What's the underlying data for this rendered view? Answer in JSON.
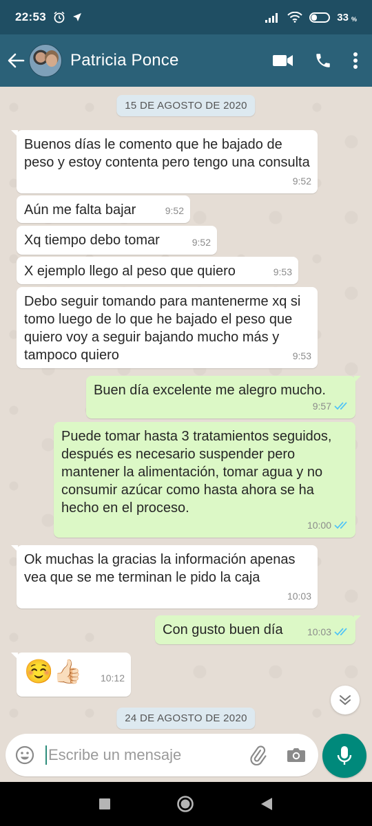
{
  "status_bar": {
    "time": "22:53",
    "battery_text": "33",
    "battery_level": 0.33
  },
  "header": {
    "contact_name": "Patricia Ponce",
    "icons": [
      "back-arrow-icon",
      "video-call-icon",
      "phone-icon",
      "more-vert-icon"
    ]
  },
  "chat": {
    "date_1": "15 DE AGOSTO DE 2020",
    "date_2": "24 DE AGOSTO DE 2020",
    "messages": [
      {
        "direction": "in",
        "text": "Buenos días le comento que he bajado de peso y estoy contenta pero tengo una consulta",
        "time": "9:52"
      },
      {
        "direction": "in",
        "text": "Aún me falta bajar",
        "time": "9:52"
      },
      {
        "direction": "in",
        "text": "Xq tiempo debo tomar",
        "time": "9:52"
      },
      {
        "direction": "in",
        "text": "X ejemplo llego al peso que quiero",
        "time": "9:53"
      },
      {
        "direction": "in",
        "text": "Debo seguir tomando para mantenerme xq si tomo luego de lo que he bajado el peso que quiero voy a seguir bajando mucho más y tampoco quiero",
        "time": "9:53"
      },
      {
        "direction": "out",
        "text": "Buen día excelente me alegro mucho.",
        "time": "9:57",
        "status": "read"
      },
      {
        "direction": "out",
        "text": "Puede tomar hasta 3 tratamientos seguidos, después es necesario suspender pero mantener  la alimentación, tomar agua y no consumir azúcar como hasta ahora se ha hecho en el proceso.",
        "time": "10:00",
        "status": "read"
      },
      {
        "direction": "in",
        "text": "Ok muchas la gracias la información apenas vea que se me terminan le pido la caja",
        "time": "10:03"
      },
      {
        "direction": "out",
        "text": "Con gusto buen día",
        "time": "10:03",
        "status": "read"
      },
      {
        "direction": "in",
        "text": "☺️👍🏻",
        "time": "10:12"
      }
    ]
  },
  "composer": {
    "placeholder": "Escribe un mensaje",
    "icons": [
      "emoji-icon",
      "attach-icon",
      "camera-icon",
      "mic-icon"
    ]
  },
  "colors": {
    "status_bar": "#1f4e63",
    "app_bar": "#2b6178",
    "outgoing_bubble": "#dcf8c6",
    "incoming_bubble": "#ffffff",
    "read_ticks": "#4fc3f7",
    "mic_button": "#00897b"
  }
}
